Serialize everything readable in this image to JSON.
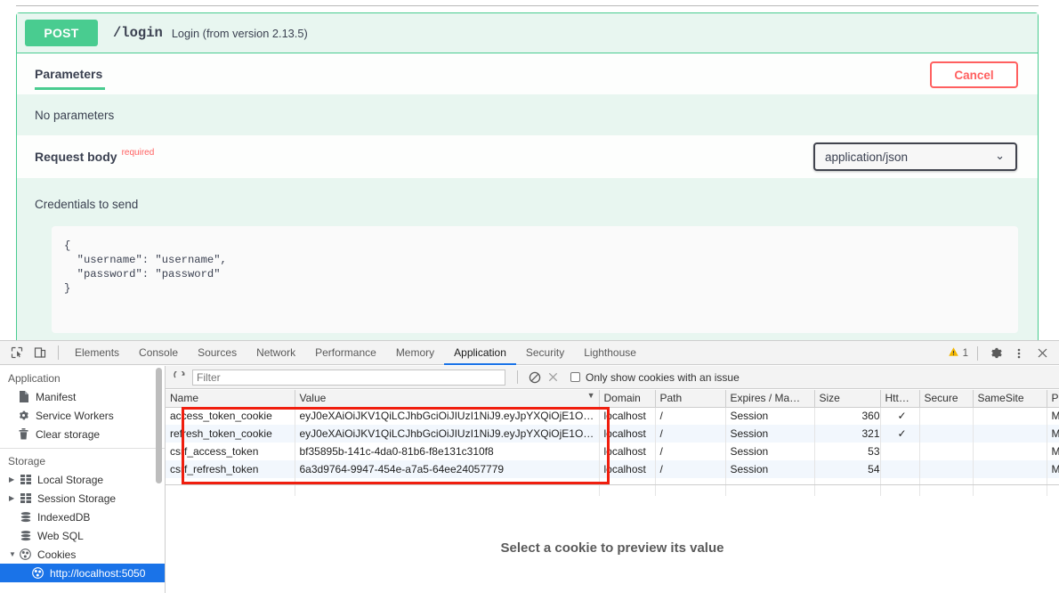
{
  "swagger": {
    "method": "POST",
    "path": "/login",
    "description": "Login (from version 2.13.5)",
    "tab_parameters": "Parameters",
    "cancel_label": "Cancel",
    "no_parameters": "No parameters",
    "request_body_label": "Request body",
    "required_label": "required",
    "content_type": "application/json",
    "chevron_icon": "chevron-down-icon",
    "credentials_label": "Credentials to send",
    "credentials_json": "{\n  \"username\": \"username\",\n  \"password\": \"password\"\n}",
    "accent_green": "#49cc90",
    "cancel_red": "#ff6060"
  },
  "devtools": {
    "left_icons": [
      {
        "name": "inspect-element-icon"
      },
      {
        "name": "device-toolbar-icon"
      }
    ],
    "tabs": [
      {
        "label": "Elements",
        "active": false
      },
      {
        "label": "Console",
        "active": false
      },
      {
        "label": "Sources",
        "active": false
      },
      {
        "label": "Network",
        "active": false
      },
      {
        "label": "Performance",
        "active": false
      },
      {
        "label": "Memory",
        "active": false
      },
      {
        "label": "Application",
        "active": true
      },
      {
        "label": "Security",
        "active": false
      },
      {
        "label": "Lighthouse",
        "active": false
      }
    ],
    "warning_count": "1",
    "warning_icon": "warning-triangle-icon",
    "settings_icon": "gear-icon",
    "more_icon": "more-vertical-icon",
    "close_icon": "close-icon",
    "active_tab_color": "#1a73e8",
    "sidebar": {
      "application_title": "Application",
      "application_items": [
        {
          "label": "Manifest",
          "icon": "document-icon"
        },
        {
          "label": "Service Workers",
          "icon": "gear-icon"
        },
        {
          "label": "Clear storage",
          "icon": "trash-icon"
        }
      ],
      "storage_title": "Storage",
      "storage_items": [
        {
          "label": "Local Storage",
          "icon": "table-icon",
          "arrow": "▶",
          "selected": false
        },
        {
          "label": "Session Storage",
          "icon": "table-icon",
          "arrow": "▶",
          "selected": false
        },
        {
          "label": "IndexedDB",
          "icon": "database-icon",
          "arrow": "",
          "selected": false
        },
        {
          "label": "Web SQL",
          "icon": "database-icon",
          "arrow": "",
          "selected": false
        },
        {
          "label": "Cookies",
          "icon": "cookie-icon",
          "arrow": "▼",
          "selected": false
        }
      ],
      "cookie_origin": {
        "label": "http://localhost:5050",
        "icon": "cookie-icon",
        "selected": true
      }
    },
    "filter_bar": {
      "refresh_icon": "refresh-icon",
      "filter_placeholder": "Filter",
      "filter_value": "",
      "clear_all_icon": "block-clear-icon",
      "delete_icon": "close-x-icon",
      "issue_checkbox_label": "Only show cookies with an issue",
      "issue_checkbox_checked": false
    },
    "cookie_table": {
      "columns": [
        {
          "label": "Name",
          "sorted": false
        },
        {
          "label": "Value",
          "sorted": true,
          "sort_arrow": "▼"
        },
        {
          "label": "Domain",
          "sorted": false
        },
        {
          "label": "Path",
          "sorted": false
        },
        {
          "label": "Expires / Ma…",
          "sorted": false
        },
        {
          "label": "Size",
          "sorted": false
        },
        {
          "label": "Htt…",
          "sorted": false
        },
        {
          "label": "Secure",
          "sorted": false
        },
        {
          "label": "SameSite",
          "sorted": false
        },
        {
          "label": "Priority",
          "sorted": false
        }
      ],
      "rows": [
        {
          "name": "access_token_cookie",
          "value": "eyJ0eXAiOiJKV1QiLCJhbGciOiJIUzI1NiJ9.eyJpYXQiOjE1OT…",
          "domain": "localhost",
          "path": "/",
          "expires": "Session",
          "size": "360",
          "httponly": "✓",
          "secure": "",
          "samesite": "",
          "priority": "Medium"
        },
        {
          "name": "refresh_token_cookie",
          "value": "eyJ0eXAiOiJKV1QiLCJhbGciOiJIUzI1NiJ9.eyJpYXQiOjE1OT…",
          "domain": "localhost",
          "path": "/",
          "expires": "Session",
          "size": "321",
          "httponly": "✓",
          "secure": "",
          "samesite": "",
          "priority": "Medium"
        },
        {
          "name": "csrf_access_token",
          "value": "bf35895b-141c-4da0-81b6-f8e131c310f8",
          "domain": "localhost",
          "path": "/",
          "expires": "Session",
          "size": "53",
          "httponly": "",
          "secure": "",
          "samesite": "",
          "priority": "Medium"
        },
        {
          "name": "csrf_refresh_token",
          "value": "6a3d9764-9947-454e-a7a5-64ee24057779",
          "domain": "localhost",
          "path": "/",
          "expires": "Session",
          "size": "54",
          "httponly": "",
          "secure": "",
          "samesite": "",
          "priority": "Medium"
        }
      ],
      "highlight_color": "#f01e0e"
    },
    "preview_message": "Select a cookie to preview its value"
  }
}
